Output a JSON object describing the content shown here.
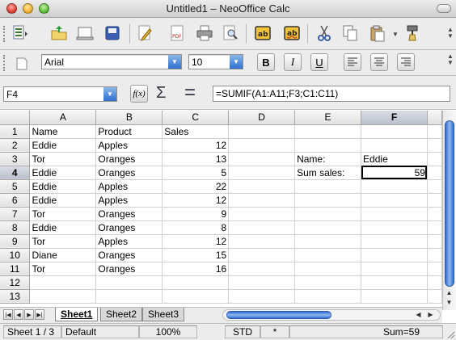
{
  "window": {
    "title": "Untitled1 – NeoOffice Calc"
  },
  "toolbar": {
    "standard_icons": [
      "new-document-icon",
      "edit-file-icon",
      "open-icon",
      "save-icon",
      "edit-icon",
      "export-pdf-icon",
      "print-icon",
      "page-preview-icon",
      "spelling-icon",
      "autospellcheck-icon",
      "cut-icon",
      "copy-icon",
      "paste-icon",
      "format-paintbrush-icon"
    ],
    "font_name": "Arial",
    "font_size": "10",
    "format_buttons": {
      "bold": "B",
      "italic": "I",
      "underline": "U"
    },
    "align_icons": [
      "align-left-icon",
      "align-center-icon",
      "align-right-icon"
    ]
  },
  "formula_bar": {
    "name_box": "F4",
    "fx_label": "f(x)",
    "sum_label": "Σ",
    "equals_label": "=",
    "formula": "=SUMIF(A1:A11;F3;C1:C11)"
  },
  "sheet": {
    "columns": [
      "A",
      "B",
      "C",
      "D",
      "E",
      "F"
    ],
    "rows": [
      {
        "n": "1",
        "A": "Name",
        "B": "Product",
        "C": "Sales",
        "D": "",
        "E": "",
        "F": ""
      },
      {
        "n": "2",
        "A": "Eddie",
        "B": "Apples",
        "C": "12",
        "D": "",
        "E": "",
        "F": ""
      },
      {
        "n": "3",
        "A": "Tor",
        "B": "Oranges",
        "C": "13",
        "D": "",
        "E": "Name:",
        "F": "Eddie"
      },
      {
        "n": "4",
        "A": "Eddie",
        "B": "Oranges",
        "C": "5",
        "D": "",
        "E": "Sum sales:",
        "F": "59"
      },
      {
        "n": "5",
        "A": "Eddie",
        "B": "Apples",
        "C": "22",
        "D": "",
        "E": "",
        "F": ""
      },
      {
        "n": "6",
        "A": "Eddie",
        "B": "Apples",
        "C": "12",
        "D": "",
        "E": "",
        "F": ""
      },
      {
        "n": "7",
        "A": "Tor",
        "B": "Oranges",
        "C": "9",
        "D": "",
        "E": "",
        "F": ""
      },
      {
        "n": "8",
        "A": "Eddie",
        "B": "Oranges",
        "C": "8",
        "D": "",
        "E": "",
        "F": ""
      },
      {
        "n": "9",
        "A": "Tor",
        "B": "Apples",
        "C": "12",
        "D": "",
        "E": "",
        "F": ""
      },
      {
        "n": "10",
        "A": "Diane",
        "B": "Oranges",
        "C": "15",
        "D": "",
        "E": "",
        "F": ""
      },
      {
        "n": "11",
        "A": "Tor",
        "B": "Oranges",
        "C": "16",
        "D": "",
        "E": "",
        "F": ""
      },
      {
        "n": "12",
        "A": "",
        "B": "",
        "C": "",
        "D": "",
        "E": "",
        "F": ""
      },
      {
        "n": "13",
        "A": "",
        "B": "",
        "C": "",
        "D": "",
        "E": "",
        "F": ""
      }
    ],
    "active_cell": "F4",
    "active_row": "4",
    "active_column": "F"
  },
  "tabs": {
    "sheets": [
      "Sheet1",
      "Sheet2",
      "Sheet3"
    ],
    "active": "Sheet1"
  },
  "status": {
    "sheet": "Sheet 1 / 3",
    "style": "Default",
    "zoom": "100%",
    "mode": "STD",
    "modified": "*",
    "sum": "Sum=59"
  },
  "colors": {
    "accent": "#2e6fd0",
    "header_bg": "#e2e2e2",
    "active_header": "#b9c0cc"
  }
}
